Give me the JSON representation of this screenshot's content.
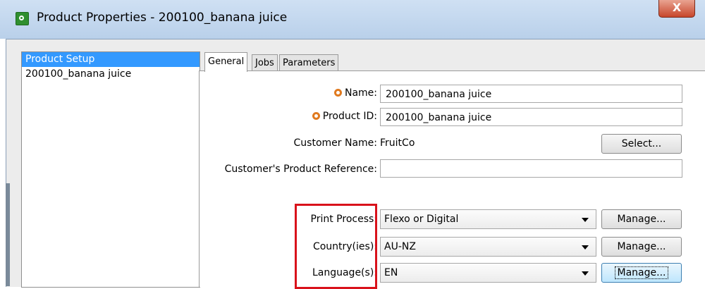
{
  "window": {
    "title": "Product Properties - 200100_banana juice",
    "close_label": "X"
  },
  "tree": {
    "items": [
      {
        "label": "Product Setup",
        "selected": true
      },
      {
        "label": "200100_banana juice",
        "selected": false
      }
    ]
  },
  "tabs": [
    {
      "label": "General",
      "active": true
    },
    {
      "label": "Jobs",
      "active": false
    },
    {
      "label": "Parameters",
      "active": false
    }
  ],
  "form": {
    "name_label": "Name:",
    "name_value": "200100_banana juice",
    "product_id_label": "Product ID:",
    "product_id_value": "200100_banana juice",
    "customer_name_label": "Customer Name:",
    "customer_name_value": "FruitCo",
    "select_button": "Select...",
    "customer_ref_label": "Customer's Product Reference:",
    "customer_ref_value": "",
    "print_process_label": "Print Process:",
    "print_process_value": "Flexo or Digital",
    "countries_label": "Country(ies):",
    "countries_value": "AU-NZ",
    "languages_label": "Language(s):",
    "languages_value": "EN",
    "manage_label": "Manage..."
  },
  "colors": {
    "selection": "#3399ff",
    "required_marker": "#e07a1f",
    "highlight_box": "#d9121b"
  }
}
